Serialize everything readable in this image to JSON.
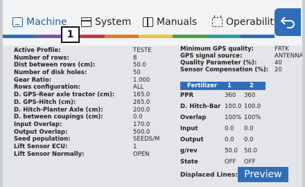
{
  "tabs": [
    {
      "label": "Machine",
      "icon": "machine-icon"
    },
    {
      "label": "System",
      "icon": "system-icon"
    },
    {
      "label": "Manuals",
      "icon": "manuals-icon"
    },
    {
      "label": "Operability",
      "icon": "operability-icon"
    }
  ],
  "badge": "1",
  "strip_colors": [
    "#2f6db8",
    "#7a52a8",
    "#c23b3b",
    "#e07b2a",
    "#e6c53a",
    "#4aa047",
    "#2a9d9a",
    "#2f6db8"
  ],
  "machine_params": [
    {
      "label": "Active Profile:",
      "value": "TESTE"
    },
    {
      "label": "Number of rows:",
      "value": "8"
    },
    {
      "label": "Dist between rows (cm):",
      "value": "50.0"
    },
    {
      "label": "Number of disk holes:",
      "value": "50"
    },
    {
      "label": "Gear Ratio:",
      "value": "1.000"
    },
    {
      "label": "Rows configuration:",
      "value": "ALL"
    },
    {
      "label": "D. GPS-Rear axle tractor (cm):",
      "value": "165.0"
    },
    {
      "label": "D. GPS-Hitch (cm):",
      "value": "265.0"
    },
    {
      "label": "D. Hitch-Planter Axle (cm):",
      "value": "200.0"
    },
    {
      "label": "D. between coupings (cm):",
      "value": "0.0"
    },
    {
      "label": "Input Overlap:",
      "value": "170.0"
    },
    {
      "label": "Output Overlap:",
      "value": "500.0"
    },
    {
      "label": "Seed population:",
      "value": "SEEDS/M"
    },
    {
      "label": "Lift Sensor ECU:",
      "value": "1"
    },
    {
      "label": "Lift Sensor Normally:",
      "value": "OPEN"
    }
  ],
  "gps_params": [
    {
      "label": "Minimum GPS quality:",
      "value": "FRTK"
    },
    {
      "label": "GPS signal source:",
      "value": "ANTENNA"
    },
    {
      "label": "Quality Parameter (%):",
      "value": "40"
    },
    {
      "label": "Sensor Compensation (%):",
      "value": "20"
    }
  ],
  "fertilizer": {
    "header": {
      "label": "Fertilizer",
      "col1": "1",
      "col2": "2"
    },
    "rows": [
      {
        "label": "PPR",
        "v1": "360",
        "v2": "360"
      },
      {
        "label": "D. Hitch-Bar",
        "v1": "100.0",
        "v2": "100.0"
      },
      {
        "label": "Overlap",
        "v1": "100%",
        "v2": "100%"
      },
      {
        "label": "Input",
        "v1": "0.0",
        "v2": "0.0"
      },
      {
        "label": "Output",
        "v1": "0.0",
        "v2": "0.0"
      },
      {
        "label": "g/rev",
        "v1": "50.0",
        "v2": "50.0"
      },
      {
        "label": "State",
        "v1": "OFF",
        "v2": "OFF"
      }
    ]
  },
  "displaced_label": "Displaced Lines:",
  "preview_label": "Preview"
}
